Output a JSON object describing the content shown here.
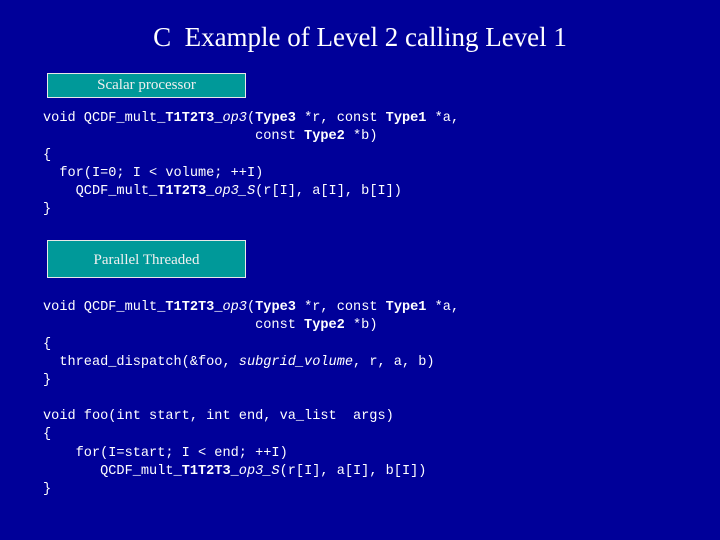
{
  "slide": {
    "title": "C  Example of Level 2 calling Level 1",
    "background_color": "#000099",
    "label_box_color": "#009999"
  },
  "sections": [
    {
      "label": "Scalar processor",
      "code_lines": [
        [
          {
            "t": "void QCDF_mult_"
          },
          {
            "t": "T1T2T3_",
            "b": true
          },
          {
            "t": "op3",
            "i": true
          },
          {
            "t": "("
          },
          {
            "t": "Type3",
            "b": true
          },
          {
            "t": " *r, const "
          },
          {
            "t": "Type1",
            "b": true
          },
          {
            "t": " *a,"
          }
        ],
        [
          {
            "t": "                          const "
          },
          {
            "t": "Type2",
            "b": true
          },
          {
            "t": " *b)"
          }
        ],
        [
          {
            "t": "{"
          }
        ],
        [
          {
            "t": "  for(I=0; I < volume; ++I)"
          }
        ],
        [
          {
            "t": "    QCDF_mult_"
          },
          {
            "t": "T1T2T3_",
            "b": true
          },
          {
            "t": "op3_S",
            "i": true
          },
          {
            "t": "(r[I], a[I], b[I])"
          }
        ],
        [
          {
            "t": "}"
          }
        ]
      ]
    },
    {
      "label": "Parallel Threaded",
      "code_lines": [
        [
          {
            "t": "void QCDF_mult_"
          },
          {
            "t": "T1T2T3_",
            "b": true
          },
          {
            "t": "op3",
            "i": true
          },
          {
            "t": "("
          },
          {
            "t": "Type3",
            "b": true
          },
          {
            "t": " *r, const "
          },
          {
            "t": "Type1",
            "b": true
          },
          {
            "t": " *a,"
          }
        ],
        [
          {
            "t": "                          const "
          },
          {
            "t": "Type2",
            "b": true
          },
          {
            "t": " *b)"
          }
        ],
        [
          {
            "t": "{"
          }
        ],
        [
          {
            "t": "  thread_dispatch(&foo, "
          },
          {
            "t": "subgrid_volume",
            "i": true
          },
          {
            "t": ", r, a, b)"
          }
        ],
        [
          {
            "t": "}"
          }
        ]
      ],
      "code_lines_2": [
        [
          {
            "t": "void foo(int start, int end, va_list  args)"
          }
        ],
        [
          {
            "t": "{"
          }
        ],
        [
          {
            "t": "    for(I=start; I < end; ++I)"
          }
        ],
        [
          {
            "t": "       QCDF_mult_"
          },
          {
            "t": "T1T2T3_",
            "b": true
          },
          {
            "t": "op3_S",
            "i": true
          },
          {
            "t": "(r[I], a[I], b[I])"
          }
        ],
        [
          {
            "t": "}"
          }
        ]
      ]
    }
  ]
}
